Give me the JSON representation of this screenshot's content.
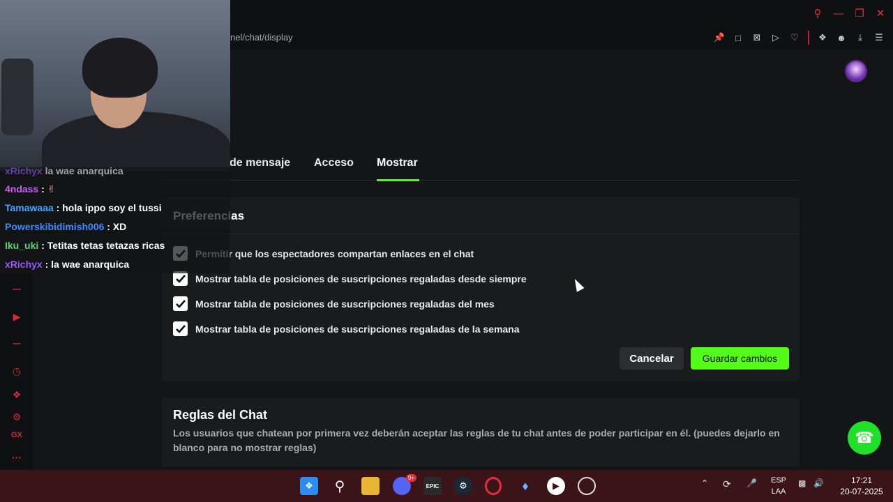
{
  "browser": {
    "url": "nel/chat/display",
    "window_controls": [
      "search-icon",
      "minimize-icon",
      "restore-icon",
      "close-icon"
    ],
    "toolbar_icons": [
      "pin-icon",
      "screenshot-icon",
      "clear-icon",
      "play-icon",
      "heart-icon",
      "extensions-icon",
      "user-icon",
      "download-icon",
      "menu-icon"
    ],
    "accent_color": "#e0303e"
  },
  "tabs": {
    "items": [
      {
        "label": "de mensaje",
        "active": false
      },
      {
        "label": "Acceso",
        "active": false
      },
      {
        "label": "Mostrar",
        "active": true
      }
    ],
    "active_color": "#53fc18"
  },
  "preferences": {
    "title": "Preferencias",
    "options": [
      {
        "label": "Permitir que los espectadores compartan enlaces en el chat",
        "checked": true
      },
      {
        "label": "Mostrar tabla de posiciones de suscripciones regaladas desde siempre",
        "checked": true
      },
      {
        "label": "Mostrar tabla de posiciones de suscripciones regaladas del mes",
        "checked": true
      },
      {
        "label": "Mostrar tabla de posiciones de suscripciones regaladas de la semana",
        "checked": true
      }
    ],
    "cancel_label": "Cancelar",
    "save_label": "Guardar cambios"
  },
  "rules": {
    "title": "Reglas del Chat",
    "description": "Los usuarios que chatean por primera vez deberán aceptar las reglas de tu chat antes de poder participar en él. (puedes dejarlo en blanco para no mostrar reglas)"
  },
  "chat": {
    "messages": [
      {
        "user": "xRichyx",
        "text": "la wae anarquica",
        "color": "#9b59ff"
      },
      {
        "user": "4ndass",
        "text": ":",
        "color": "#c85cf5"
      },
      {
        "user": "Tamawaaa",
        "text": ": hola ippo soy el tussi",
        "color": "#4aa3ff"
      },
      {
        "user": "Powerskibidimish006",
        "text": ": XD",
        "color": "#3d8bff"
      },
      {
        "user": "Iku_uki",
        "text": ": Tetitas tetas tetazas ricas",
        "color": "#5fd17a"
      },
      {
        "user": "xRichyx",
        "text": ": la wae anarquica",
        "color": "#9b59ff"
      }
    ]
  },
  "sidebar_icons": [
    "play-icon",
    "history-icon",
    "extensions-icon",
    "settings-icon",
    "gx-icon",
    "more-icon"
  ],
  "sidebar_gx_label": "GX",
  "sidebar_more_label": "···",
  "taskbar": {
    "apps": [
      "windows-icon",
      "search-icon",
      "file-explorer-icon",
      "discord-icon",
      "epic-games-icon",
      "steam-icon",
      "opera-gx-icon",
      "app-icon",
      "media-player-icon",
      "obs-icon"
    ],
    "discord_badge": "9+",
    "epic_label": "EPIC",
    "language_top": "ESP",
    "language_bottom": "LAA",
    "time": "17:21",
    "date": "20-07-2025"
  }
}
